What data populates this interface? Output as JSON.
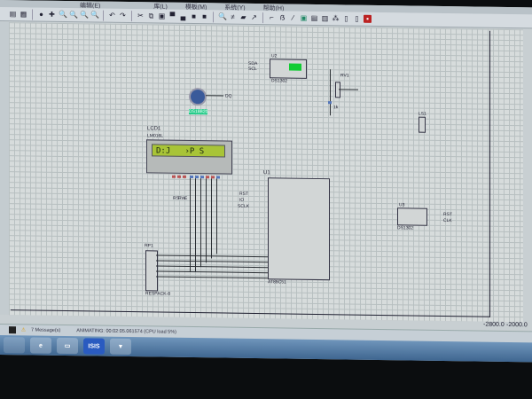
{
  "menu": [
    "编辑(E)",
    "库(L)",
    "模板(M)",
    "系统(Y)",
    "帮助(H)"
  ],
  "toolbar_icons": [
    "new-sheet",
    "grid",
    "origin",
    "pan",
    "zoom-in",
    "zoom-out",
    "zoom-all",
    "zoom-area",
    "undo",
    "redo",
    "cut",
    "copy",
    "paste",
    "block-copy",
    "block-move",
    "block-rotate",
    "block-delete",
    "pick-device",
    "make-device",
    "packaging",
    "decompose",
    "wire-autorouter",
    "search-tag",
    "property-assign",
    "new-sheet-2",
    "remove-sheet",
    "bom",
    "netlist",
    "erc",
    "ares"
  ],
  "schematic": {
    "lcd": {
      "ref": "LCD1",
      "part": "LM016L",
      "text": "D:J   ›P S"
    },
    "mcu": {
      "ref": "U1",
      "part": "AT89C51"
    },
    "respack": {
      "ref": "RP1",
      "part": "RESPACK-8"
    },
    "pot": {
      "ref": "RV1",
      "label": "1k"
    },
    "u2": {
      "ref": "U2",
      "part": "DS1302"
    },
    "u3": {
      "ref": "U3",
      "part": "DS1302"
    },
    "sensor": {
      "part": "DS18B20"
    },
    "speaker": {
      "ref": "LS1"
    },
    "net_labels": [
      "SDA",
      "SCL",
      "RST",
      "IO",
      "SCLK",
      "RS",
      "RW",
      "E",
      "DQ",
      "RST",
      "CLK"
    ]
  },
  "status": {
    "messages": "7 Message(s)",
    "animating": "ANIMATING: 00:02:05.061574 (CPU load 5%)",
    "coords": [
      "-2800.0",
      "-2000.0"
    ]
  },
  "taskbar": {
    "items": [
      "ie",
      "explorer",
      "ISIS",
      "proteus"
    ],
    "isis_label": "ISIS"
  }
}
